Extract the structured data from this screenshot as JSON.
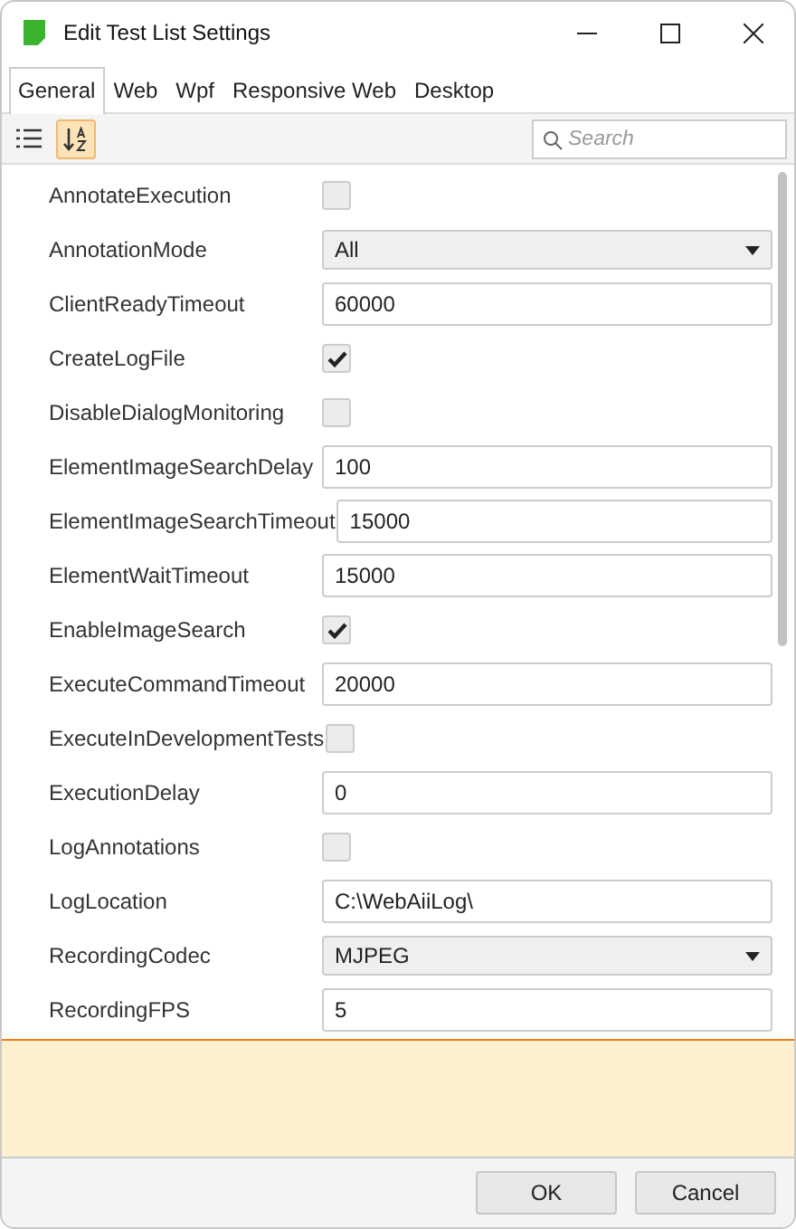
{
  "window": {
    "title": "Edit Test List Settings"
  },
  "tabs": [
    {
      "label": "General",
      "selected": true
    },
    {
      "label": "Web",
      "selected": false
    },
    {
      "label": "Wpf",
      "selected": false
    },
    {
      "label": "Responsive Web",
      "selected": false
    },
    {
      "label": "Desktop",
      "selected": false
    }
  ],
  "toolbar": {
    "categorized_selected": false,
    "alphabetical_selected": true
  },
  "search": {
    "placeholder": "Search"
  },
  "properties": [
    {
      "name": "AnnotateExecution",
      "kind": "checkbox",
      "checked": false
    },
    {
      "name": "AnnotationMode",
      "kind": "dropdown",
      "value": "All"
    },
    {
      "name": "ClientReadyTimeout",
      "kind": "text",
      "value": "60000"
    },
    {
      "name": "CreateLogFile",
      "kind": "checkbox",
      "checked": true
    },
    {
      "name": "DisableDialogMonitoring",
      "kind": "checkbox",
      "checked": false
    },
    {
      "name": "ElementImageSearchDelay",
      "kind": "text",
      "value": "100"
    },
    {
      "name": "ElementImageSearchTimeout",
      "kind": "text",
      "value": "15000"
    },
    {
      "name": "ElementWaitTimeout",
      "kind": "text",
      "value": "15000"
    },
    {
      "name": "EnableImageSearch",
      "kind": "checkbox",
      "checked": true
    },
    {
      "name": "ExecuteCommandTimeout",
      "kind": "text",
      "value": "20000"
    },
    {
      "name": "ExecuteInDevelopmentTests",
      "kind": "checkbox",
      "checked": false
    },
    {
      "name": "ExecutionDelay",
      "kind": "text",
      "value": "0"
    },
    {
      "name": "LogAnnotations",
      "kind": "checkbox",
      "checked": false
    },
    {
      "name": "LogLocation",
      "kind": "text",
      "value": "C:\\WebAiiLog\\"
    },
    {
      "name": "RecordingCodec",
      "kind": "dropdown",
      "value": "MJPEG"
    },
    {
      "name": "RecordingFPS",
      "kind": "text",
      "value": "5"
    }
  ],
  "buttons": [
    "OK",
    "Cancel"
  ]
}
